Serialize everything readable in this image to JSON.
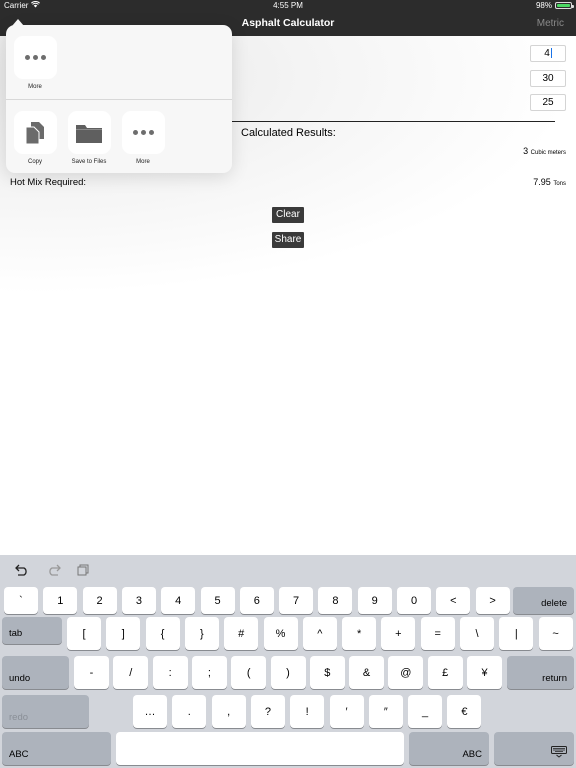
{
  "status": {
    "carrier": "Carrier",
    "time": "4:55 PM",
    "battery": "98%",
    "battery_level": 0.98
  },
  "nav": {
    "title": "Asphalt Calculator",
    "right": "Metric"
  },
  "inputs": [
    "4",
    "30",
    "25"
  ],
  "results": {
    "title": "Calculated Results:",
    "volume_value": "3",
    "volume_unit": "Cubic meters",
    "hotmix_label": "Hot Mix Required:",
    "hotmix_value": "7.95",
    "hotmix_unit": "Tons"
  },
  "buttons": {
    "clear": "Clear",
    "share": "Share"
  },
  "share_sheet": {
    "top_row": [
      {
        "label": "More",
        "icon": "more-icon"
      }
    ],
    "bottom_row": [
      {
        "label": "Copy",
        "icon": "copy-icon"
      },
      {
        "label": "Save to Files",
        "icon": "folder-icon"
      },
      {
        "label": "More",
        "icon": "more-icon"
      }
    ]
  },
  "keyboard": {
    "toolbar": [
      "undo-icon",
      "redo-icon",
      "paste-icon"
    ],
    "row1": [
      "`",
      "1",
      "2",
      "3",
      "4",
      "5",
      "6",
      "7",
      "8",
      "9",
      "0",
      "<",
      ">"
    ],
    "row1_delete": "delete",
    "row2_tab": "tab",
    "row2": [
      "[",
      "]",
      "{",
      "}",
      "#",
      "%",
      "^",
      "*",
      "+",
      "=",
      "\\",
      "|",
      "~"
    ],
    "row3_undo": "undo",
    "row3": [
      "-",
      "/",
      ":",
      ";",
      "(",
      ")",
      "$",
      "&",
      "@",
      "£",
      "¥"
    ],
    "row3_return": "return",
    "row4_redo": "redo",
    "row4": [
      "…",
      ".",
      ",",
      "?",
      "!",
      "′",
      "″",
      "_",
      "€"
    ],
    "row5_abc_left": "ABC",
    "row5_abc_right": "ABC"
  }
}
